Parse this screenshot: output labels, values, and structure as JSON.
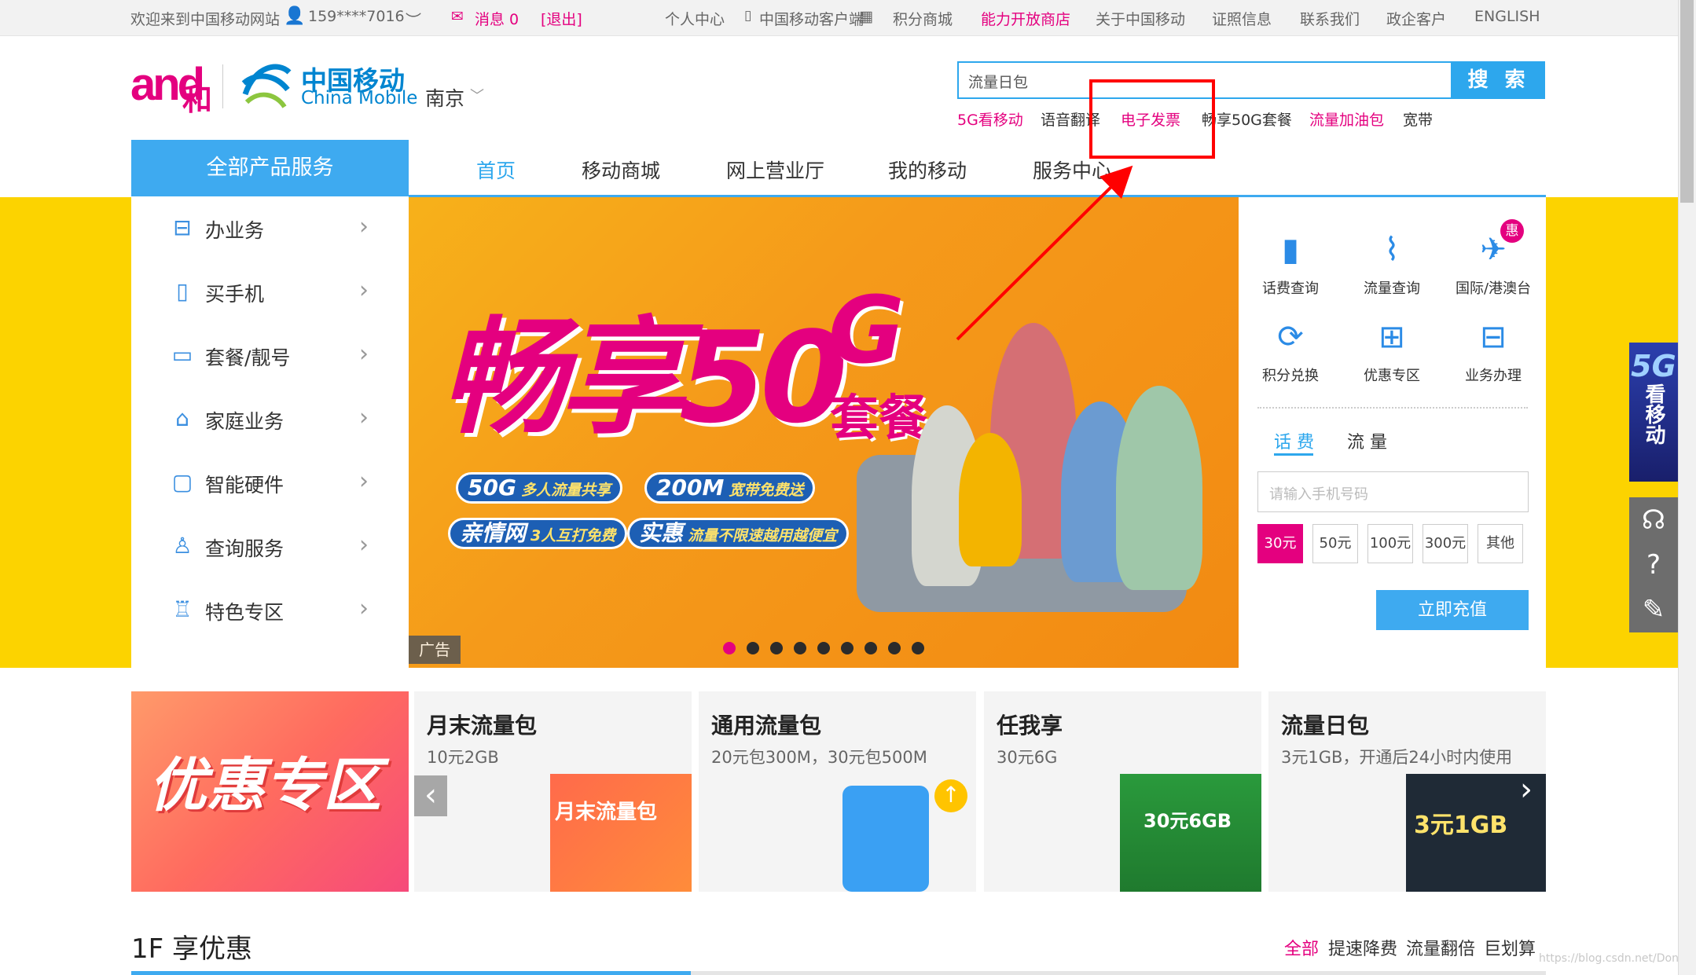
{
  "topbar": {
    "welcome": "欢迎来到中国移动网站",
    "phone": "159****7016",
    "message": "消息 0",
    "logout": "[退出]",
    "links": [
      "个人中心",
      "中国移动客户端",
      "积分商城",
      "能力开放商店",
      "关于中国移动",
      "证照信息",
      "联系我们",
      "政企客户",
      "ENGLISH"
    ]
  },
  "header": {
    "logo_and": "and",
    "logo_he": "和",
    "logo_cn": "中国移动",
    "logo_en": "China Mobile",
    "city": "南京",
    "search_value": "流量日包",
    "search_button": "搜 索",
    "hot_links": [
      "5G看移动",
      "语音翻译",
      "电子发票",
      "畅享50G套餐",
      "流量加油包",
      "宽带"
    ]
  },
  "nav": {
    "all_products": "全部产品服务",
    "items": [
      "首页",
      "移动商城",
      "网上营业厅",
      "我的移动",
      "服务中心"
    ]
  },
  "side_menu": [
    "办业务",
    "买手机",
    "套餐/靓号",
    "家庭业务",
    "智能硬件",
    "查询服务",
    "特色专区"
  ],
  "banner": {
    "headline": "畅享50",
    "g": "G",
    "package": "套餐",
    "pills": [
      {
        "big": "50G",
        "small": "多人流量共享"
      },
      {
        "big": "200M",
        "small": "宽带免费送"
      },
      {
        "big": "亲情网",
        "small": "3人互打免费"
      },
      {
        "big": "实惠",
        "small": "流量不限速越用越便宜"
      }
    ],
    "ad_tag": "广告",
    "dot_count": 9,
    "active_dot": 0
  },
  "quick_panel": {
    "items": [
      "话费查询",
      "流量查询",
      "国际/港澳台",
      "积分兑换",
      "优惠专区",
      "业务办理"
    ],
    "badge": "惠",
    "tabs": [
      "话 费",
      "流 量"
    ],
    "phone_placeholder": "请输入手机号码",
    "amounts": [
      "30元",
      "50元",
      "100元",
      "300元",
      "其他"
    ],
    "selected_amount": "30元",
    "pay_button": "立即充值"
  },
  "floating": {
    "top": "5G",
    "bottom": "看移动"
  },
  "promo": {
    "big_title": "优惠专区",
    "cards": [
      {
        "title": "月末流量包",
        "sub": "10元2GB",
        "img_text": "月末流量包"
      },
      {
        "title": "通用流量包",
        "sub": "20元包300M，30元包500M",
        "img_text": ""
      },
      {
        "title": "任我享",
        "sub": "30元6G",
        "img_text": "30元6GB"
      },
      {
        "title": "流量日包",
        "sub": "3元1GB，开通后24小时内使用",
        "img_text": "3元1GB"
      }
    ]
  },
  "floor": {
    "title": "1F 享优惠",
    "tabs": [
      "全部",
      "提速降费",
      "流量翻倍",
      "巨划算"
    ]
  },
  "watermark": "https://blog.csdn.net/Don",
  "colors": {
    "brand_pink": "#e4007f",
    "brand_blue": "#2da7ed",
    "banner_yellow": "#fcd300"
  }
}
